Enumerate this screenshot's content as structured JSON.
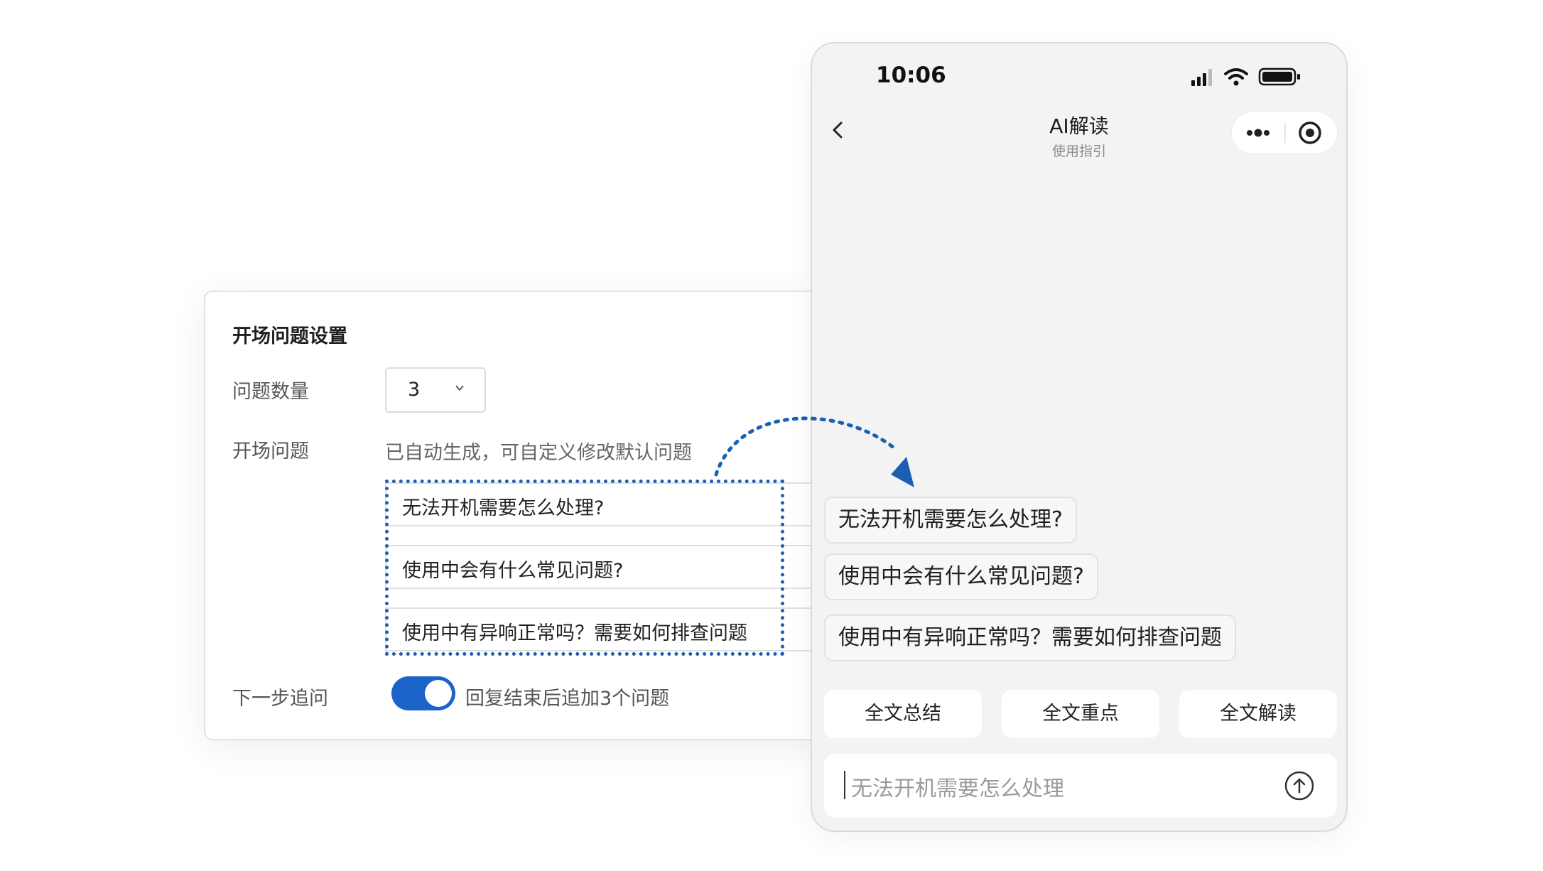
{
  "settings": {
    "title": "开场问题设置",
    "count_label": "问题数量",
    "count_value": "3",
    "questions_label": "开场问题",
    "questions_hint": "已自动生成，可自定义修改默认问题",
    "questions": [
      "无法开机需要怎么处理?",
      "使用中会有什么常见问题?",
      "使用中有异响正常吗？需要如何排查问题"
    ],
    "followup_label": "下一步追问",
    "followup_enabled": true,
    "followup_text": "回复结束后追加3个问题"
  },
  "phone": {
    "time": "10:06",
    "title": "AI解读",
    "subtitle": "使用指引",
    "bubbles": [
      "无法开机需要怎么处理?",
      "使用中会有什么常见问题?",
      "使用中有异响正常吗？需要如何排查问题"
    ],
    "actions": [
      "全文总结",
      "全文重点",
      "全文解读"
    ],
    "input_value": "无法开机需要怎么处理"
  },
  "colors": {
    "accent": "#1c63c9",
    "dotted_border": "#1a5fb4",
    "phone_bg": "#f3f3f3"
  },
  "icons": [
    "chevron-down-icon",
    "signal-icon",
    "wifi-icon",
    "battery-icon",
    "back-icon",
    "more-icon",
    "target-icon",
    "send-arrow-icon"
  ]
}
